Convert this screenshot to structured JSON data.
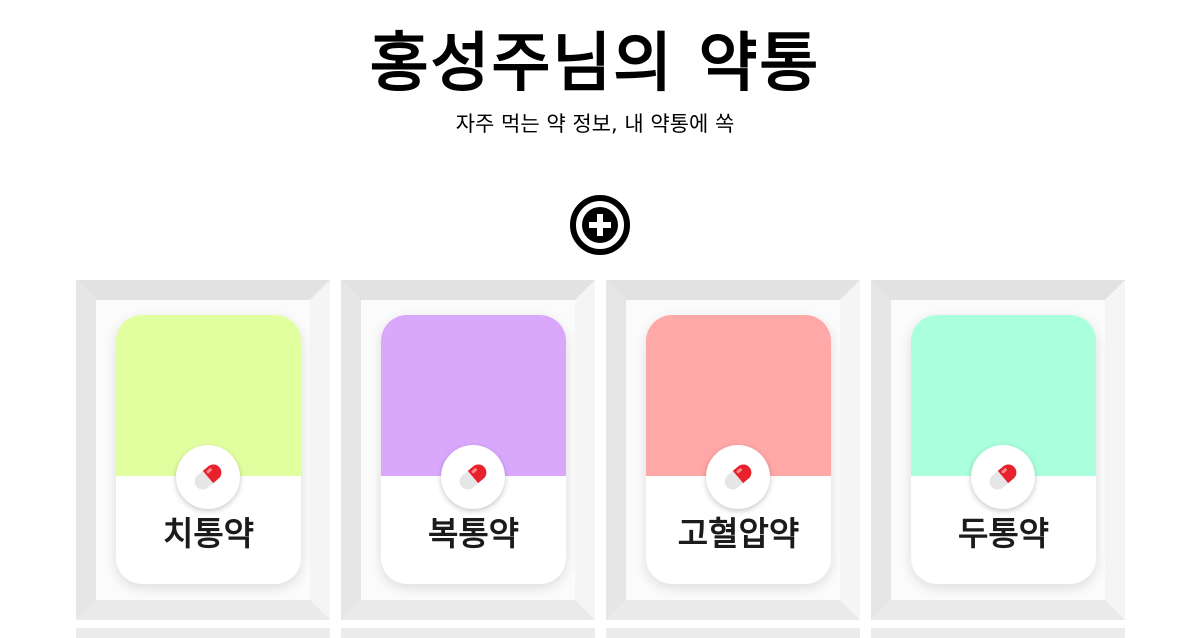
{
  "header": {
    "title": "홍성주님의 약통",
    "subtitle": "자주 먹는 약 정보, 내 약통에 쏙"
  },
  "add_button": {
    "icon": "plus-circle-icon"
  },
  "medicines": [
    {
      "name": "치통약",
      "color": "#e2ffa0",
      "icon": "pill-icon"
    },
    {
      "name": "복통약",
      "color": "#d9a8fd",
      "icon": "pill-icon"
    },
    {
      "name": "고혈압약",
      "color": "#ffa8a8",
      "icon": "pill-icon"
    },
    {
      "name": "두통약",
      "color": "#aaffdd",
      "icon": "pill-icon"
    }
  ],
  "colors": {
    "frame_outer": "#ececec",
    "frame_inner": "#fafafa",
    "pill_red": "#e8222c",
    "pill_white": "#e6e6e6"
  }
}
